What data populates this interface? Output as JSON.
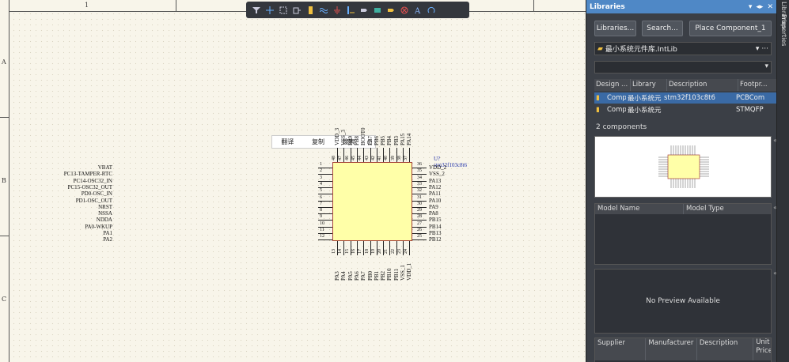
{
  "sheet": {
    "zone_number": "1",
    "zone_letters": [
      "A",
      "B",
      "C"
    ]
  },
  "toolbar": {
    "tools": [
      "filter-icon",
      "crosshair-icon",
      "select-rect-icon",
      "move-icon",
      "part-icon",
      "wire-icon",
      "ground-icon",
      "bus-icon",
      "port-icon",
      "sheet-entry-icon",
      "parameter-icon",
      "no-erc-icon",
      "text-icon",
      "arc-icon"
    ]
  },
  "context_menu": {
    "items": [
      "翻译",
      "复制",
      "搜索"
    ]
  },
  "component": {
    "designator": "U?",
    "comment": "stm32f103c8t6",
    "left_pins": [
      {
        "name": "VBAT",
        "num": "1"
      },
      {
        "name": "PC13-TAMPER-RTC",
        "num": "2"
      },
      {
        "name": "PC14-OSC32_IN",
        "num": "3"
      },
      {
        "name": "PC15-OSC32_OUT",
        "num": "4"
      },
      {
        "name": "PD0-OSC_IN",
        "num": "5"
      },
      {
        "name": "PD1-OSC_OUT",
        "num": "6"
      },
      {
        "name": "NRST",
        "num": "7"
      },
      {
        "name": "NSSA",
        "num": "8"
      },
      {
        "name": "NDDA",
        "num": "9"
      },
      {
        "name": "PA0-WKUP",
        "num": "10"
      },
      {
        "name": "PA1",
        "num": "11"
      },
      {
        "name": "PA2",
        "num": "12"
      }
    ],
    "right_pins": [
      {
        "name": "VDD_2",
        "num": "36"
      },
      {
        "name": "VSS_2",
        "num": "35"
      },
      {
        "name": "PA13",
        "num": "34"
      },
      {
        "name": "PA12",
        "num": "33"
      },
      {
        "name": "PA11",
        "num": "32"
      },
      {
        "name": "PA10",
        "num": "31"
      },
      {
        "name": "PA9",
        "num": "30"
      },
      {
        "name": "PA8",
        "num": "29"
      },
      {
        "name": "PB15",
        "num": "28"
      },
      {
        "name": "PB14",
        "num": "27"
      },
      {
        "name": "PB13",
        "num": "26"
      },
      {
        "name": "PB12",
        "num": "25"
      }
    ],
    "top_pins": [
      {
        "name": "VDD_3",
        "num": "48"
      },
      {
        "name": "VSS_3",
        "num": "47"
      },
      {
        "name": "PB9",
        "num": "46"
      },
      {
        "name": "PB8",
        "num": "45"
      },
      {
        "name": "BOOT0",
        "num": "44"
      },
      {
        "name": "PB7",
        "num": "43"
      },
      {
        "name": "PB6",
        "num": "42"
      },
      {
        "name": "PB5",
        "num": "41"
      },
      {
        "name": "PB4",
        "num": "40"
      },
      {
        "name": "PB3",
        "num": "39"
      },
      {
        "name": "PA15",
        "num": "38"
      },
      {
        "name": "PA14",
        "num": "37"
      }
    ],
    "bottom_pins": [
      {
        "name": "PA3",
        "num": "13"
      },
      {
        "name": "PA4",
        "num": "14"
      },
      {
        "name": "PA5",
        "num": "15"
      },
      {
        "name": "PA6",
        "num": "16"
      },
      {
        "name": "PA7",
        "num": "17"
      },
      {
        "name": "PB0",
        "num": "18"
      },
      {
        "name": "PB1",
        "num": "19"
      },
      {
        "name": "PB2",
        "num": "20"
      },
      {
        "name": "PB10",
        "num": "21"
      },
      {
        "name": "PB11",
        "num": "22"
      },
      {
        "name": "VSS_1",
        "num": "23"
      },
      {
        "name": "VDD_1",
        "num": "24"
      }
    ]
  },
  "panel": {
    "title": "Libraries",
    "header_controls": [
      "▾",
      "◂▸",
      "✕"
    ],
    "buttons": {
      "libraries": "Libraries...",
      "search": "Search...",
      "place": "Place Component_1"
    },
    "library_name": "最小系统元件库.IntLib",
    "filter_value": "",
    "columns": [
      "Design ...",
      "Library",
      "Description",
      "Footpr..."
    ],
    "rows": [
      {
        "design": "Comp",
        "library": "最小系统元",
        "description": "stm32f103c8t6",
        "footprint": "PCBCom"
      },
      {
        "design": "Comp",
        "library": "最小系统元",
        "description": "",
        "footprint": "STMQFP"
      }
    ],
    "count_text": "2 components",
    "model_headers": [
      "Model Name",
      "Model Type"
    ],
    "no_preview": "No Preview Available",
    "supplier_headers": [
      "Supplier",
      "Manufacturer",
      "Description",
      "Unit Price"
    ],
    "side_tabs": [
      "Libraries",
      "Properties"
    ]
  },
  "colors": {
    "canvas": "#f8f5ea",
    "chip_fill": "#ffffa8",
    "panel_bg": "#3b3f46",
    "panel_header": "#4f88c6",
    "selected_row": "#3a6aa5"
  }
}
